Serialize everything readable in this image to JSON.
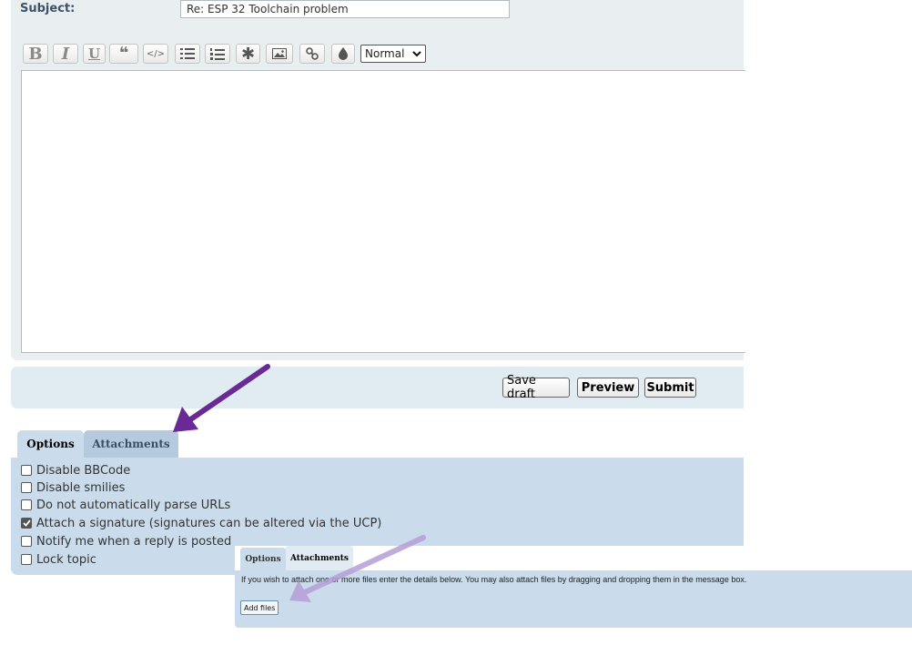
{
  "subject": {
    "label": "Subject:",
    "value": "Re: ESP 32 Toolchain problem"
  },
  "toolbar": {
    "buttons": [
      {
        "name": "bold-button",
        "icon": "bold-icon",
        "glyph": "B"
      },
      {
        "name": "italic-button",
        "icon": "italic-icon",
        "glyph": "I"
      },
      {
        "name": "underline-button",
        "icon": "underline-icon",
        "glyph": "U"
      },
      {
        "name": "quote-button",
        "icon": "quote-icon",
        "glyph": "❝"
      },
      {
        "name": "code-button",
        "icon": "code-icon",
        "glyph": "</>"
      },
      {
        "name": "list-button",
        "icon": "list-icon"
      },
      {
        "name": "numbered-list-button",
        "icon": "numbered-list-icon"
      },
      {
        "name": "list-item-button",
        "icon": "asterisk-icon",
        "glyph": "✱"
      },
      {
        "name": "image-button",
        "icon": "image-icon"
      },
      {
        "name": "link-button",
        "icon": "link-icon"
      },
      {
        "name": "color-button",
        "icon": "droplet-icon"
      }
    ],
    "font_size": "Normal"
  },
  "message": {
    "value": ""
  },
  "actions": {
    "save_draft": "Save draft",
    "preview": "Preview",
    "submit": "Submit"
  },
  "tabs": {
    "options": "Options",
    "attachments": "Attachments"
  },
  "options": [
    {
      "label": "Disable BBCode",
      "checked": false
    },
    {
      "label": "Disable smilies",
      "checked": false
    },
    {
      "label": "Do not automatically parse URLs",
      "checked": false
    },
    {
      "label": "Attach a signature (signatures can be altered via the UCP)",
      "checked": true
    },
    {
      "label": "Notify me when a reply is posted",
      "checked": false
    },
    {
      "label": "Lock topic",
      "checked": false
    }
  ],
  "inset": {
    "tab_options": "Options",
    "tab_attachments": "Attachments",
    "help_text": "If you wish to attach one or more files enter the details below. You may also attach files by dragging and dropping them in the message box.",
    "add_files": "Add files"
  },
  "colors": {
    "panel": "#e9eef1",
    "options_panel": "#cadceb",
    "arrow_dark": "#6a2a96",
    "arrow_light": "#b59ed6"
  }
}
